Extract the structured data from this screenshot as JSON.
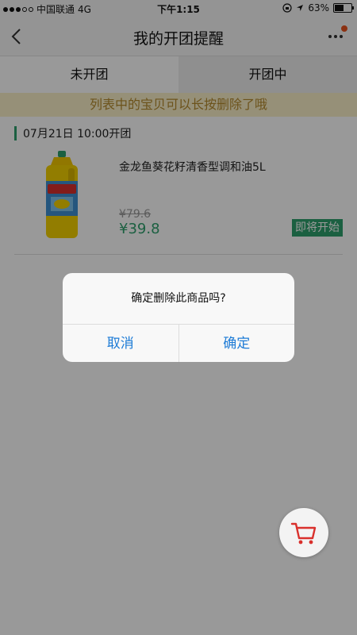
{
  "status_bar": {
    "carrier": "中国联通",
    "network": "4G",
    "time": "下午1:15",
    "battery": "63%",
    "battery_level": 0.63
  },
  "nav": {
    "title": "我的开团提醒",
    "back_icon": "chevron-left-icon",
    "more_icon": "more-dots-icon"
  },
  "tabs": [
    {
      "label": "未开团",
      "active": false
    },
    {
      "label": "开团中",
      "active": true
    }
  ],
  "notice": "列表中的宝贝可以长按删除了哦",
  "group": {
    "date": "07月21日 10:00开团",
    "product": {
      "name": "金龙鱼葵花籽清香型调和油5L",
      "old_price": "¥79.6",
      "new_price": "¥39.8",
      "status": "即将开始"
    }
  },
  "dialog": {
    "message": "确定删除此商品吗?",
    "cancel": "取消",
    "confirm": "确定"
  },
  "colors": {
    "accent_green": "#2ea06d",
    "notice_text": "#b58a2d",
    "dialog_blue": "#1d7bd6",
    "cart_red": "#d9302c",
    "badge_orange": "#e8531f"
  },
  "cart_icon": "shopping-cart-icon"
}
